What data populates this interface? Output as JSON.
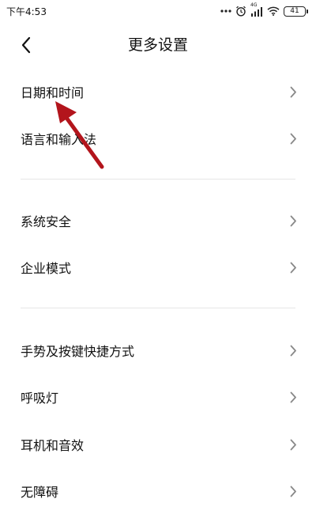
{
  "status_bar": {
    "time": "下午4:53",
    "network_label": "4G",
    "battery_level": "41",
    "icons": [
      "more-dots-icon",
      "alarm-icon",
      "signal-icon",
      "wifi-icon",
      "battery-icon"
    ]
  },
  "header": {
    "title": "更多设置",
    "back_icon": "chevron-left-icon"
  },
  "groups": [
    {
      "items": [
        {
          "label": "日期和时间",
          "icon": "chevron-right-icon"
        },
        {
          "label": "语言和输入法",
          "icon": "chevron-right-icon"
        }
      ]
    },
    {
      "items": [
        {
          "label": "系统安全",
          "icon": "chevron-right-icon"
        },
        {
          "label": "企业模式",
          "icon": "chevron-right-icon"
        }
      ]
    },
    {
      "items": [
        {
          "label": "手势及按键快捷方式",
          "icon": "chevron-right-icon"
        },
        {
          "label": "呼吸灯",
          "icon": "chevron-right-icon"
        },
        {
          "label": "耳机和音效",
          "icon": "chevron-right-icon"
        },
        {
          "label": "无障碍",
          "icon": "chevron-right-icon"
        }
      ]
    }
  ],
  "annotation": {
    "arrow_color": "#b3151c"
  }
}
